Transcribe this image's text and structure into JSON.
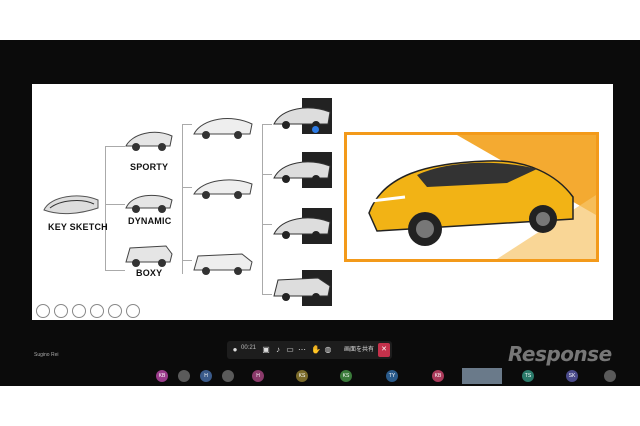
{
  "slide": {
    "labels": {
      "key_sketch": "KEY SKETCH",
      "sporty": "SPORTY",
      "dynamic": "DYNAMIC",
      "boxy": "BOXY"
    }
  },
  "toolbar": {
    "timer": "00:21",
    "share_label": "画面を共有",
    "leave_label": "✕"
  },
  "self_name": "Sugino Rei",
  "participants": [
    {
      "initials": "KB",
      "color": "#9a3b8a"
    },
    {
      "initials": "",
      "color": "#5a5a5a"
    },
    {
      "initials": "H",
      "color": "#3a5a8a"
    },
    {
      "initials": "",
      "color": "#5a5a5a"
    },
    {
      "initials": "H",
      "color": "#8a3a6a"
    },
    {
      "initials": "KS",
      "color": "#7a6a2a"
    },
    {
      "initials": "KS",
      "color": "#3a7a3a"
    },
    {
      "initials": "TY",
      "color": "#2a5a8a"
    },
    {
      "initials": "KB",
      "color": "#aa3a5a"
    },
    {
      "initials": "TS",
      "color": "#2a7a6a"
    },
    {
      "initials": "SK",
      "color": "#4a4a8a"
    },
    {
      "initials": "",
      "color": "#5a5a5a"
    }
  ],
  "watermark": "Response",
  "colors": {
    "accent": "#f39a1a",
    "leave": "#c4314b"
  }
}
